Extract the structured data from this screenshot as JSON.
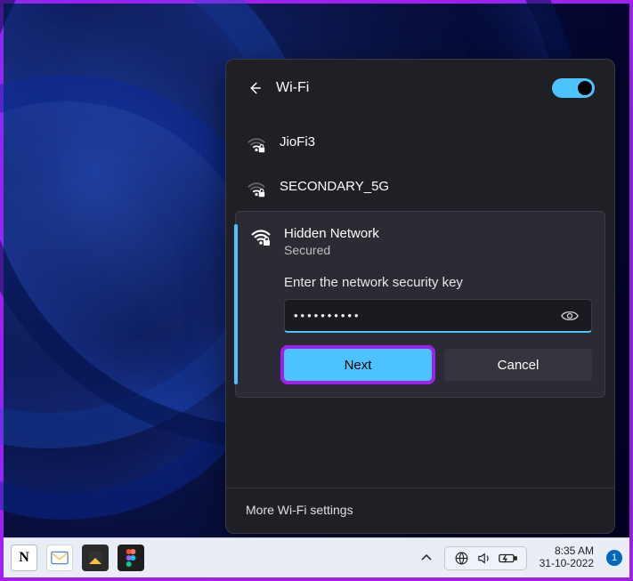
{
  "flyout": {
    "title": "Wi-Fi",
    "toggle_on": true,
    "more_settings": "More Wi-Fi settings"
  },
  "networks": [
    {
      "name": "JioFi3",
      "secured": true,
      "signal": 2
    },
    {
      "name": "SECONDARY_5G",
      "secured": true,
      "signal": 2
    }
  ],
  "selected_network": {
    "name": "Hidden Network",
    "status": "Secured",
    "prompt": "Enter the network security key",
    "password_mask": "●●●●●●●●●●",
    "next_label": "Next",
    "cancel_label": "Cancel"
  },
  "taskbar": {
    "apps": [
      {
        "id": "notion",
        "label": "N"
      },
      {
        "id": "mail",
        "label": "mail"
      },
      {
        "id": "sticky-notes",
        "label": "notes"
      },
      {
        "id": "figma",
        "label": "figma"
      }
    ],
    "clock_time": "8:35 AM",
    "clock_date": "31-10-2022",
    "notification_count": "1"
  }
}
